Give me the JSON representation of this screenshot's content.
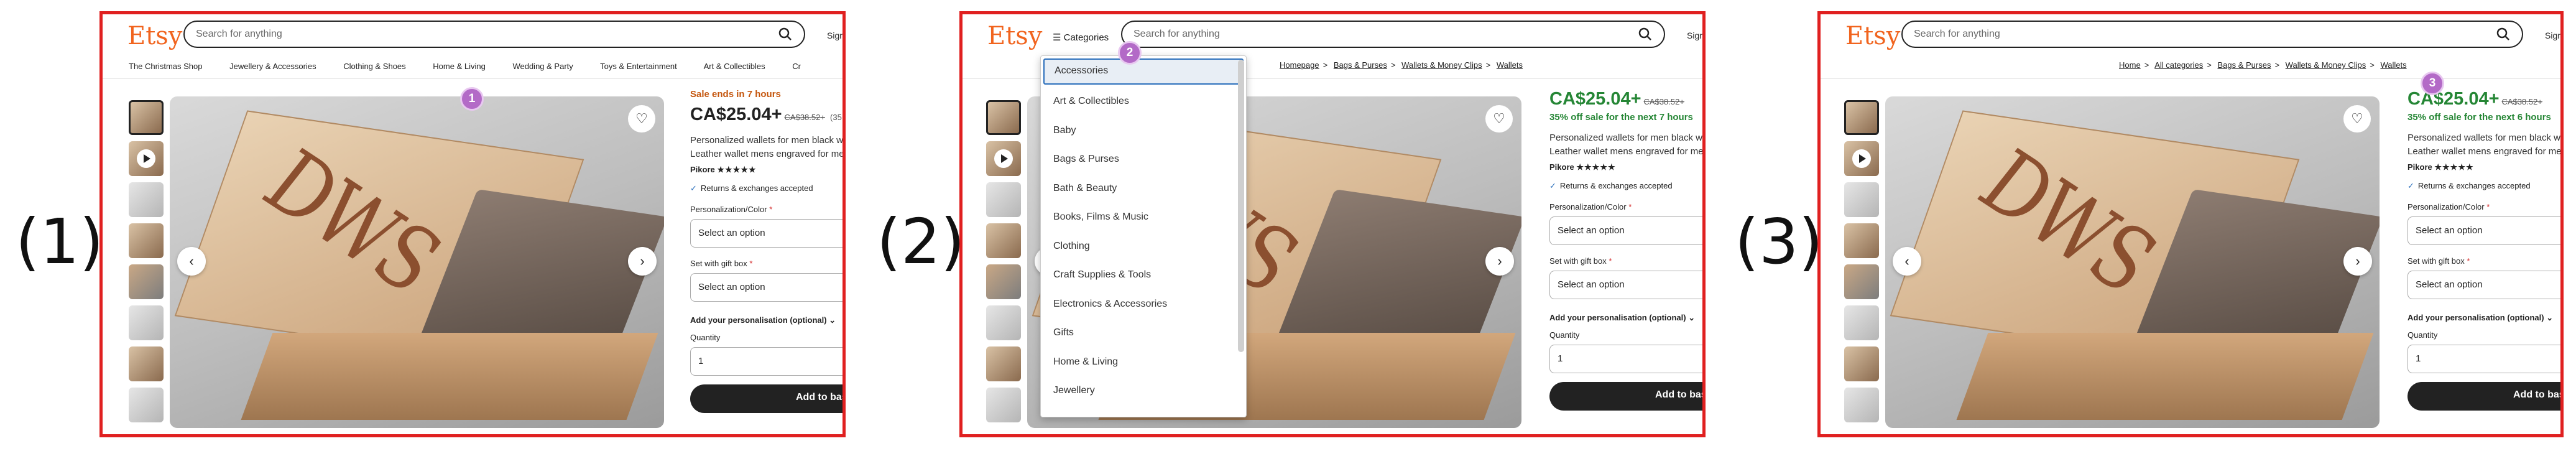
{
  "steps": [
    "(1)",
    "(2)",
    "(3)"
  ],
  "markers": [
    "1",
    "2",
    "3"
  ],
  "header": {
    "logo": "Etsy",
    "search_placeholder": "Search for anything",
    "signin": "Sign",
    "categories_label": "Categories"
  },
  "category_nav": [
    "The Christmas Shop",
    "Jewellery & Accessories",
    "Clothing & Shoes",
    "Home & Living",
    "Wedding & Party",
    "Toys & Entertainment",
    "Art & Collectibles",
    "Cr"
  ],
  "breadcrumb_2": [
    "Homepage",
    "Bags & Purses",
    "Wallets & Money Clips",
    "Wallets"
  ],
  "breadcrumb_3": [
    "Home",
    "All categories",
    "Bags & Purses",
    "Wallets & Money Clips",
    "Wallets"
  ],
  "dropdown_items": [
    "Accessories",
    "Art & Collectibles",
    "Baby",
    "Bags & Purses",
    "Bath & Beauty",
    "Books, Films & Music",
    "Clothing",
    "Craft Supplies & Tools",
    "Electronics & Accessories",
    "Gifts",
    "Home & Living",
    "Jewellery"
  ],
  "product": {
    "sale_ends": "Sale ends in 7 hours",
    "price": "CA$25.04+",
    "original_price": "CA$38.52+",
    "discount": "(35",
    "sale_note_2": "35% off sale for the next 7 hours",
    "sale_note_3": "35% off sale for the next 6 hours",
    "description": "Personalized wallets for men black wallet, Leather wallet mens engraved for men wallet",
    "shop": "Pikore",
    "stars": "★★★★★",
    "returns": "Returns & exchanges accepted",
    "personalization_label": "Personalization/Color",
    "gift_box_label": "Set with gift box",
    "select_placeholder": "Select an option",
    "add_personalisation": "Add your personalisation (optional)",
    "quantity_label": "Quantity",
    "quantity_value": "1",
    "add_to_basket": "Add to bas",
    "image_text": "DWS",
    "required_mark": "*"
  },
  "colors": {
    "accent": "#f1641e",
    "border": "#e02020",
    "sale": "#258635",
    "marker": "#b36ac7"
  }
}
